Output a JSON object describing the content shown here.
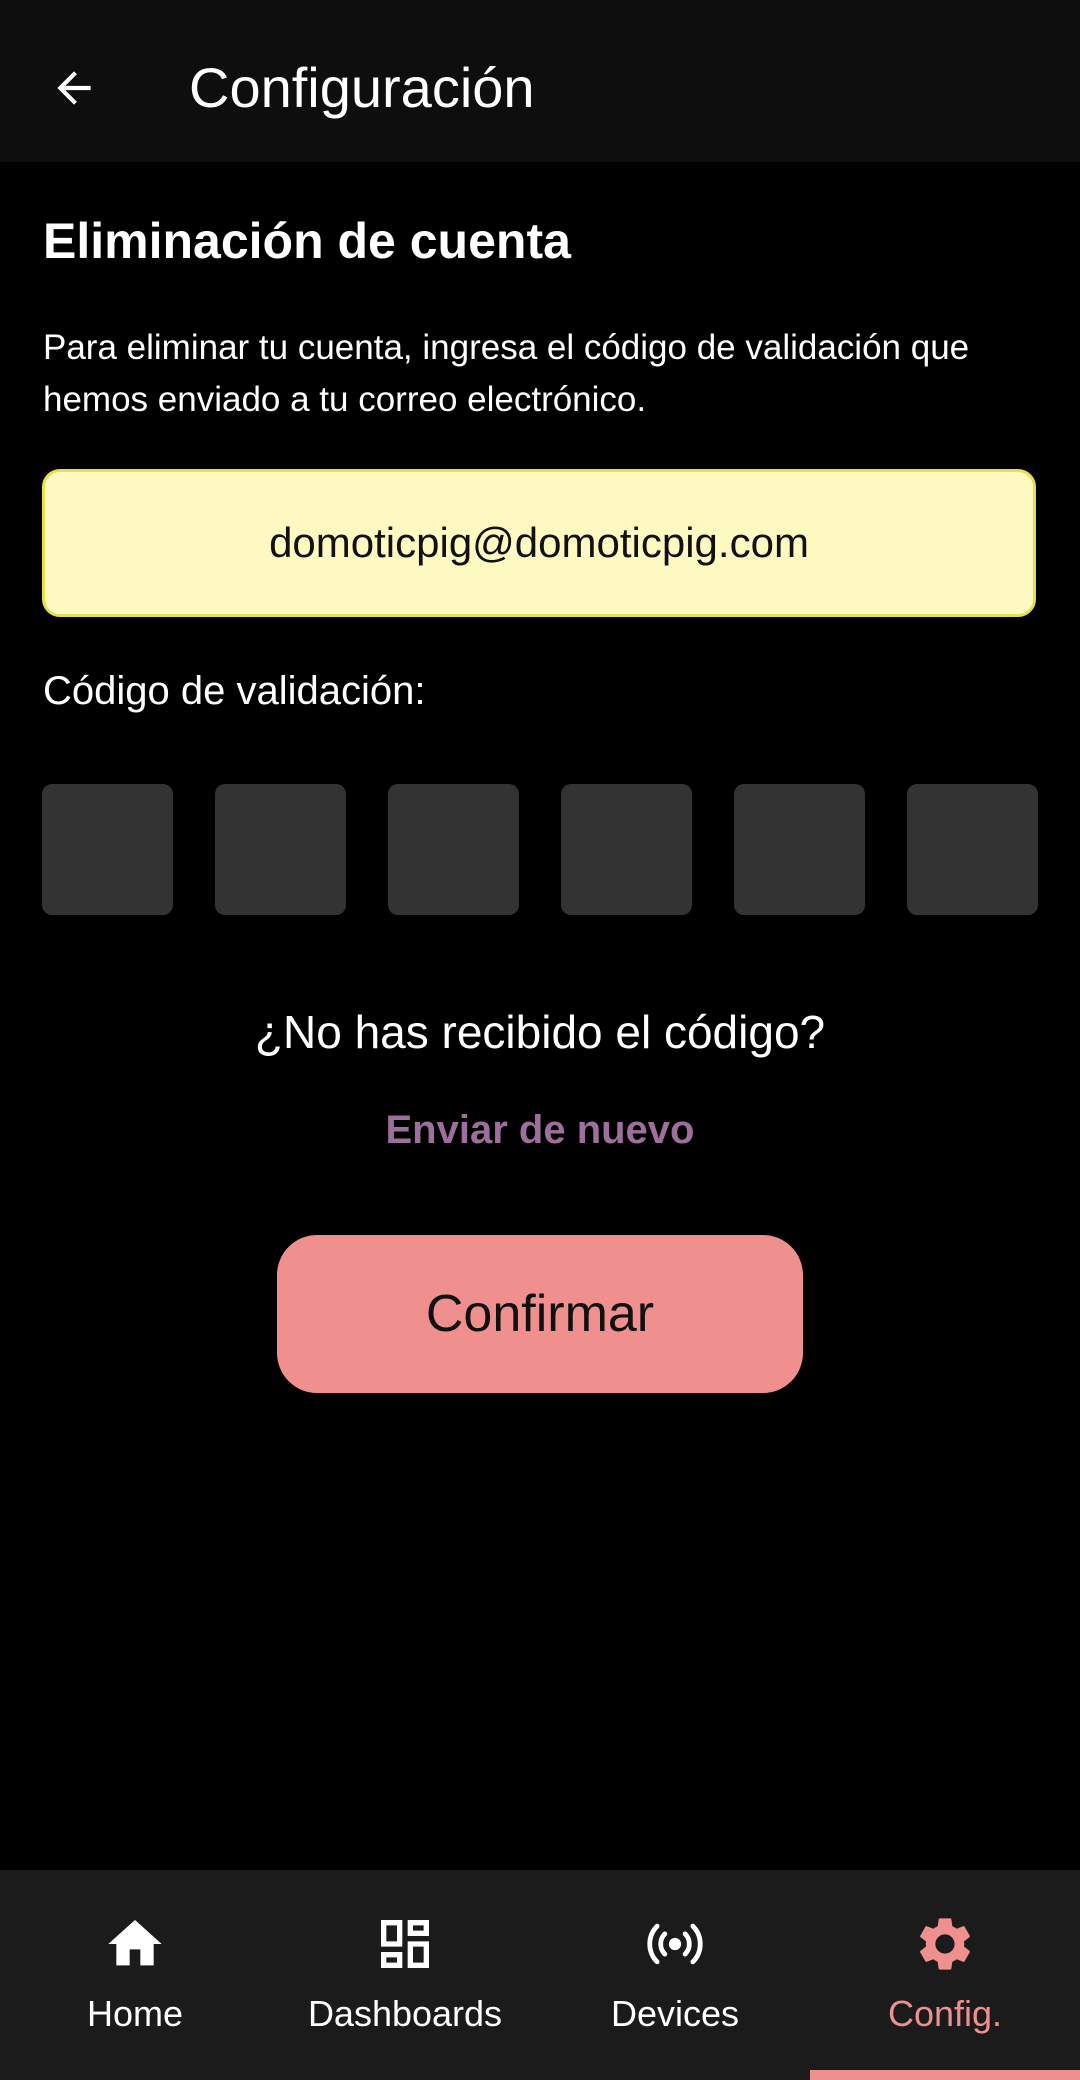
{
  "appbar": {
    "title": "Configuración",
    "back_icon": "arrow-left-icon"
  },
  "section": {
    "title": "Eliminación de cuenta",
    "description": "Para eliminar tu cuenta, ingresa el código de validación que hemos enviado a tu correo electrónico."
  },
  "email": "domoticpig@domoticpig.com",
  "code": {
    "label": "Código de validación:",
    "digits": [
      "",
      "",
      "",
      "",
      "",
      ""
    ]
  },
  "resend": {
    "question": "¿No has recibido el código?",
    "link": "Enviar de nuevo"
  },
  "confirm_label": "Confirmar",
  "nav": {
    "items": [
      {
        "label": "Home",
        "icon": "home-icon"
      },
      {
        "label": "Dashboards",
        "icon": "dashboard-icon"
      },
      {
        "label": "Devices",
        "icon": "broadcast-icon"
      },
      {
        "label": "Config.",
        "icon": "gear-icon"
      }
    ],
    "active": "Config."
  },
  "colors": {
    "accent": "#ef8f8e",
    "link": "#9d6f9a",
    "email_bg": "#fef9c0",
    "email_border": "#e7df4b",
    "code_box": "#333333",
    "appbar_bg": "#0e0e0e",
    "nav_bg": "#1b1b1b"
  }
}
